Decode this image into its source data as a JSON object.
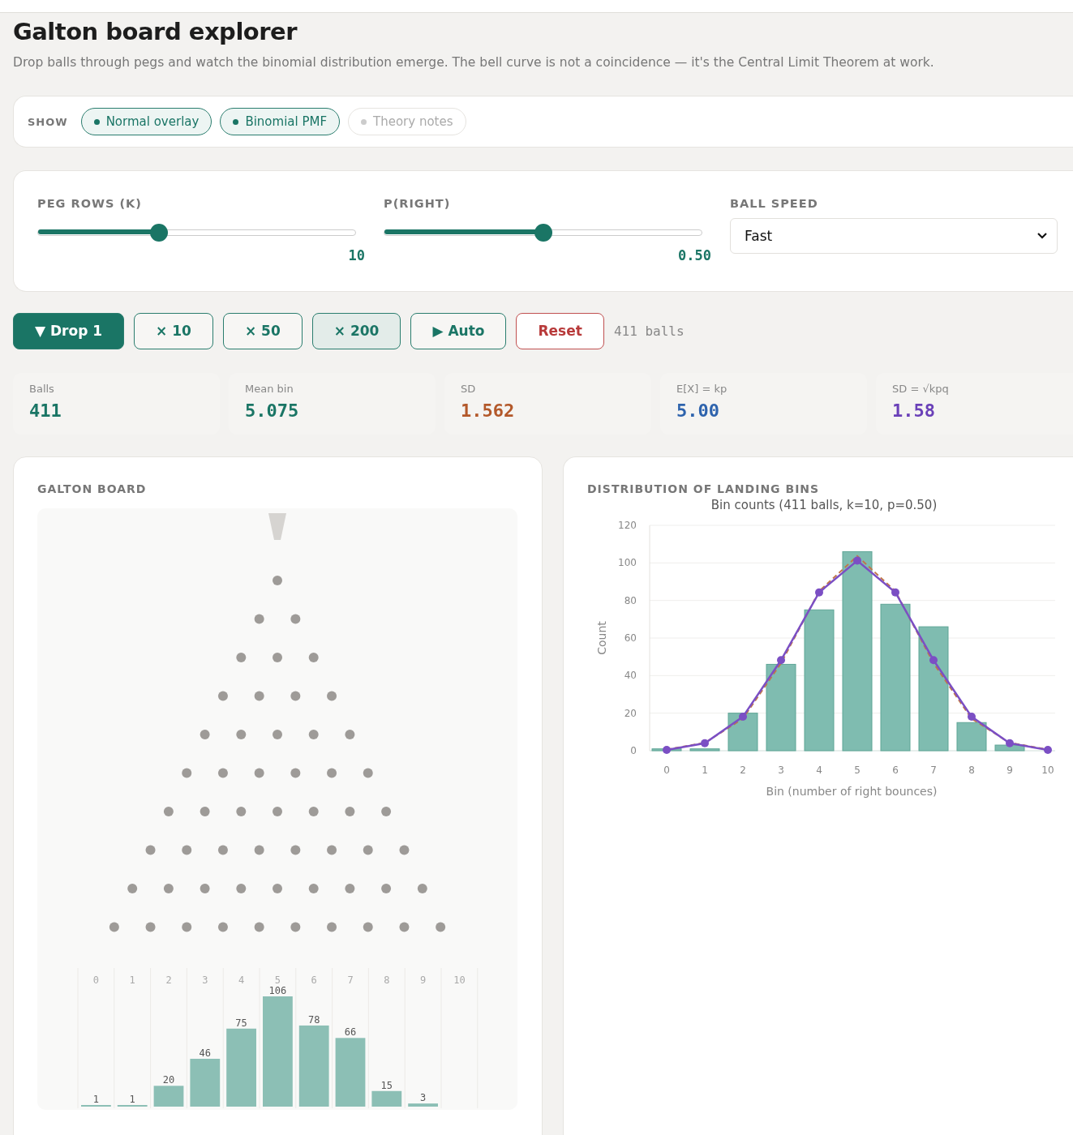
{
  "title": "Galton board explorer",
  "description": "Drop balls through pegs and watch the binomial distribution emerge. The bell curve is not a coincidence — it's the Central Limit Theorem at work.",
  "show": {
    "label": "SHOW",
    "toggles": [
      {
        "label": "Normal overlay",
        "on": true
      },
      {
        "label": "Binomial PMF",
        "on": true
      },
      {
        "label": "Theory notes",
        "on": false
      }
    ]
  },
  "controls": {
    "sliders": [
      {
        "label": "PEG ROWS (K)",
        "level": 0.38,
        "reading": "10"
      },
      {
        "label": "P(RIGHT)",
        "level": 0.5,
        "reading": "0.50"
      }
    ],
    "speed": {
      "label": "BALL SPEED",
      "value": "Fast"
    }
  },
  "actions": [
    {
      "label": "▼ Drop 1",
      "kind": "primary"
    },
    {
      "label": "× 10",
      "kind": "outline"
    },
    {
      "label": "× 50",
      "kind": "outline"
    },
    {
      "label": "× 200",
      "kind": "hover"
    },
    {
      "label": "▶ Auto",
      "kind": "outline"
    },
    {
      "label": "Reset",
      "kind": "danger"
    }
  ],
  "ball_count": "411 balls",
  "stats": [
    {
      "label": "Balls",
      "value": "411",
      "color": "#1a7565"
    },
    {
      "label": "Mean bin",
      "value": "5.075",
      "color": "#1a7565"
    },
    {
      "label": "SD",
      "value": "1.562",
      "color": "#b3582a"
    },
    {
      "label": "E[X] = kp",
      "value": "5.00",
      "color": "#2e63ad"
    },
    {
      "label": "SD = √kpq",
      "value": "1.58",
      "color": "#6a40b8"
    }
  ],
  "board": {
    "title": "GALTON BOARD",
    "chart_data": {
      "type": "bar",
      "categories": [
        "0",
        "1",
        "2",
        "3",
        "4",
        "5",
        "6",
        "7",
        "8",
        "9",
        "10"
      ],
      "values": [
        1,
        1,
        20,
        46,
        75,
        106,
        78,
        66,
        15,
        3,
        null
      ],
      "data_labels": true
    }
  },
  "distribution": {
    "title": "DISTRIBUTION OF LANDING BINS",
    "chart_data": {
      "type": "bar",
      "title": "Bin counts (411 balls, k=10, p=0.50)",
      "xlabel": "Bin (number of right bounces)",
      "ylabel": "Count",
      "categories": [
        "0",
        "1",
        "2",
        "3",
        "4",
        "5",
        "6",
        "7",
        "8",
        "9",
        "10"
      ],
      "ylim": [
        0,
        120
      ],
      "yticks": [
        0,
        20,
        40,
        60,
        80,
        100,
        120
      ],
      "grid": true,
      "series": [
        {
          "type": "bar",
          "color": "#7fbcb0",
          "values": [
            1,
            1,
            20,
            46,
            75,
            106,
            78,
            66,
            15,
            3,
            0
          ]
        },
        {
          "type": "line",
          "line_style": "dashed",
          "marker": "none",
          "color": "#c0764a",
          "values": [
            0.7,
            4.2,
            17.1,
            46.6,
            84.9,
            103.7,
            84.9,
            46.6,
            17.1,
            4.2,
            0.7
          ]
        },
        {
          "type": "line",
          "line_style": "solid",
          "marker": "circle",
          "color": "#7b4fc4",
          "values": [
            0.4,
            4.0,
            18.1,
            48.2,
            84.3,
            101.2,
            84.3,
            48.2,
            18.1,
            4.0,
            0.4
          ]
        }
      ]
    }
  }
}
